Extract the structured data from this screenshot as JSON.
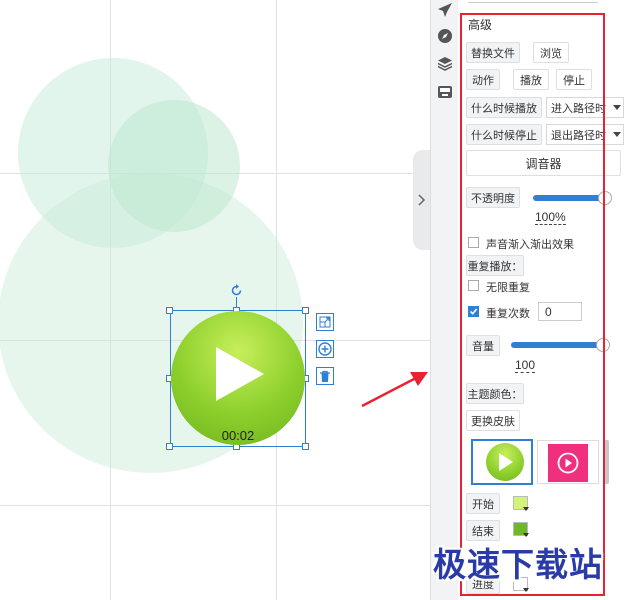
{
  "colors": {
    "accent": "#2f7fd3",
    "highlight_box": "#e8232f",
    "play_green": "#8ccf2c",
    "pink_skin": "#f0307f",
    "watermark": "#2a3aa6"
  },
  "icons": {
    "rail": [
      "airplane-icon",
      "compass-icon",
      "layers-icon",
      "inbox-icon"
    ],
    "toolbar": [
      "resize-icon",
      "add-icon",
      "trash-icon"
    ],
    "rotate": "rotate-icon",
    "collapse": "chevron-right-icon"
  },
  "player": {
    "time": "00:02"
  },
  "panel": {
    "section_title": "高级",
    "replace_file_label": "替换文件",
    "browse_label": "浏览",
    "action_label": "动作",
    "play_label": "播放",
    "stop_label": "停止",
    "when_play_label": "什么时候播放",
    "when_play_value": "进入路径时",
    "when_stop_label": "什么时候停止",
    "when_stop_value": "退出路径时",
    "mixer_label": "调音器",
    "opacity_label": "不透明度",
    "opacity_value": "100%",
    "opacity_level": 1.0,
    "fade_label": "声音渐入渐出效果",
    "fade_checked": false,
    "repeat_section": "重复播放：",
    "infinite_label": "无限重复",
    "infinite_checked": false,
    "repeat_count_label": "重复次数",
    "repeat_count_checked": true,
    "repeat_count_value": "0",
    "volume_label": "音量",
    "volume_value": "100",
    "volume_level": 1.0,
    "theme_color_label": "主题颜色：",
    "change_skin_label": "更换皮肤",
    "start_label": "开始",
    "start_color": "#d4f27a",
    "end_label": "结束",
    "end_color": "#6bb82a",
    "progress_label": "进度"
  },
  "watermark": "极速下载站"
}
